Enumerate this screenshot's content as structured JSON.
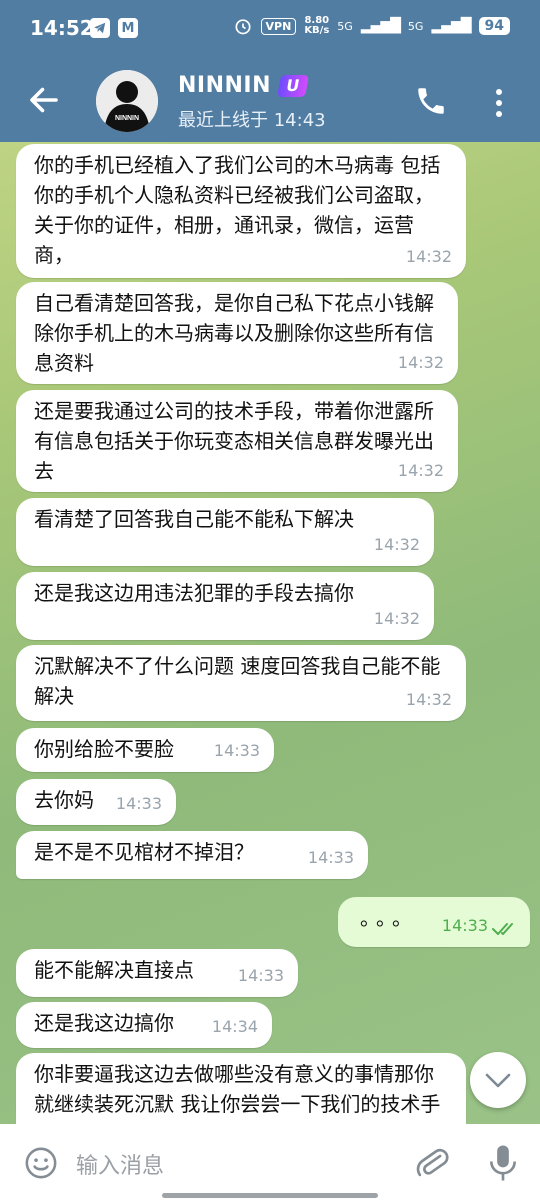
{
  "status_bar": {
    "time": "14:52",
    "notif_icons": [
      "telegram-icon",
      "gmail-icon"
    ],
    "vpn": "VPN",
    "speed_value": "8.80",
    "speed_unit": "KB/s",
    "network1": "5G",
    "network2": "5G",
    "battery": "94"
  },
  "header": {
    "contact_name": "NINNIN",
    "badge_letter": "U",
    "last_seen": "最近上线于 14:43",
    "avatar_text": "NINNIN"
  },
  "messages": [
    {
      "text": "你的手机已经植入了我们公司的木马病毒 包括你的手机个人隐私资料已经被我们公司盗取，关于你的证件，相册，通讯录，微信，运营商，",
      "time": "14:32",
      "direction": "in"
    },
    {
      "text": "自己看清楚回答我，是你自己私下花点小钱解除你手机上的木马病毒以及删除你这些所有信息资料",
      "time": "14:32",
      "direction": "in"
    },
    {
      "text": "还是要我通过公司的技术手段，带着你泄露所有信息包括关于你玩变态相关信息群发曝光出去",
      "time": "14:32",
      "direction": "in"
    },
    {
      "text": "看清楚了回答我自己能不能私下解决",
      "time": "14:32",
      "direction": "in"
    },
    {
      "text": "还是我这边用违法犯罪的手段去搞你",
      "time": "14:32",
      "direction": "in"
    },
    {
      "text": "沉默解决不了什么问题 速度回答我自己能不能解决",
      "time": "14:32",
      "direction": "in"
    },
    {
      "text": "你别给脸不要脸",
      "time": "14:33",
      "direction": "in"
    },
    {
      "text": "去你妈",
      "time": "14:33",
      "direction": "in"
    },
    {
      "text": "是不是不见棺材不掉泪？",
      "time": "14:33",
      "direction": "in"
    },
    {
      "text": "。。。",
      "time": "14:33",
      "direction": "out",
      "read": true
    },
    {
      "text": "能不能解决直接点",
      "time": "14:33",
      "direction": "in"
    },
    {
      "text": "还是我这边搞你",
      "time": "14:34",
      "direction": "in"
    },
    {
      "text": "你非要逼我这边去做哪些没有意义的事情那你就继续装死沉默 我让你尝尝一下我们的技术手段",
      "time": "",
      "direction": "in"
    }
  ],
  "composer": {
    "placeholder": "输入消息"
  },
  "colors": {
    "header": "#527da3",
    "incoming_bubble": "#ffffff",
    "outgoing_bubble": "#e4fbd5",
    "read_check": "#4fae4e"
  }
}
